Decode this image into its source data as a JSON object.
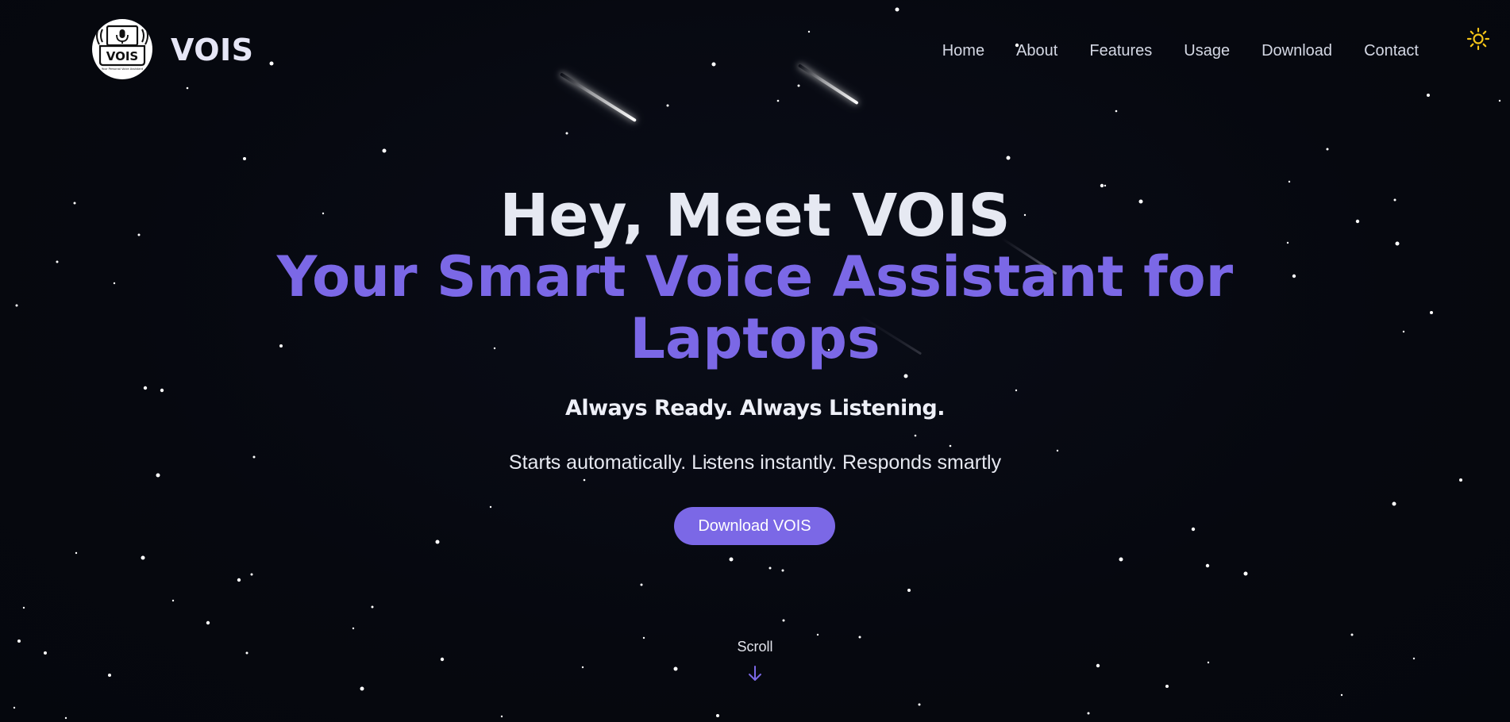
{
  "header": {
    "brand": "VOIS",
    "logo": {
      "icon": "microphone-laptop-icon",
      "text": "VOIS",
      "caption": "Your Personal Voice Assistant"
    },
    "nav": [
      {
        "label": "Home"
      },
      {
        "label": "About"
      },
      {
        "label": "Features"
      },
      {
        "label": "Usage"
      },
      {
        "label": "Download"
      },
      {
        "label": "Contact"
      }
    ],
    "theme_toggle": {
      "icon": "sun-icon",
      "color": "#f5c518"
    }
  },
  "hero": {
    "title": "Hey, Meet VOIS",
    "subtitle_line1": "Your Smart Voice Assistant for",
    "subtitle_line2": "Laptops",
    "tagline": "Always Ready. Always Listening.",
    "description": "Starts automatically. Listens instantly. Responds smartly",
    "cta_label": "Download VOIS"
  },
  "scroll": {
    "label": "Scroll",
    "icon": "arrow-down-icon"
  },
  "colors": {
    "background": "#06080f",
    "accent": "#7b68e6",
    "title": "#e6e9f2",
    "text": "#d4d8e4"
  }
}
